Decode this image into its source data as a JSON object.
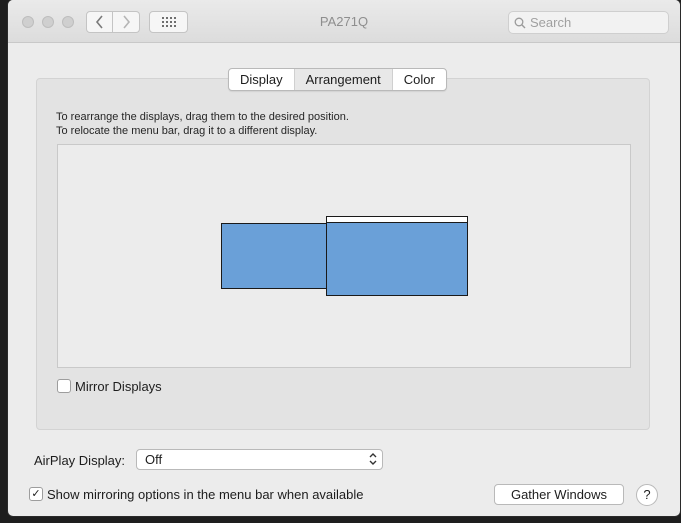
{
  "window": {
    "title": "PA271Q"
  },
  "toolbar": {
    "back_icon": "chevron-left-icon",
    "forward_icon": "chevron-right-icon",
    "grid_icon": "grid-icon",
    "search_placeholder": "Search"
  },
  "tabs": [
    {
      "label": "Display",
      "selected": false
    },
    {
      "label": "Arrangement",
      "selected": true
    },
    {
      "label": "Color",
      "selected": false
    }
  ],
  "arrangement": {
    "hint_line1": "To rearrange the displays, drag them to the desired position.",
    "hint_line2": "To relocate the menu bar, drag it to a different display.",
    "display_color": "#6aa0d8"
  },
  "mirror": {
    "label": "Mirror Displays",
    "checked": false
  },
  "airplay": {
    "label": "AirPlay Display:",
    "value": "Off"
  },
  "menu_option": {
    "label": "Show mirroring options in the menu bar when available",
    "checked": true,
    "mark": "✓"
  },
  "buttons": {
    "gather": "Gather Windows",
    "help": "?"
  }
}
